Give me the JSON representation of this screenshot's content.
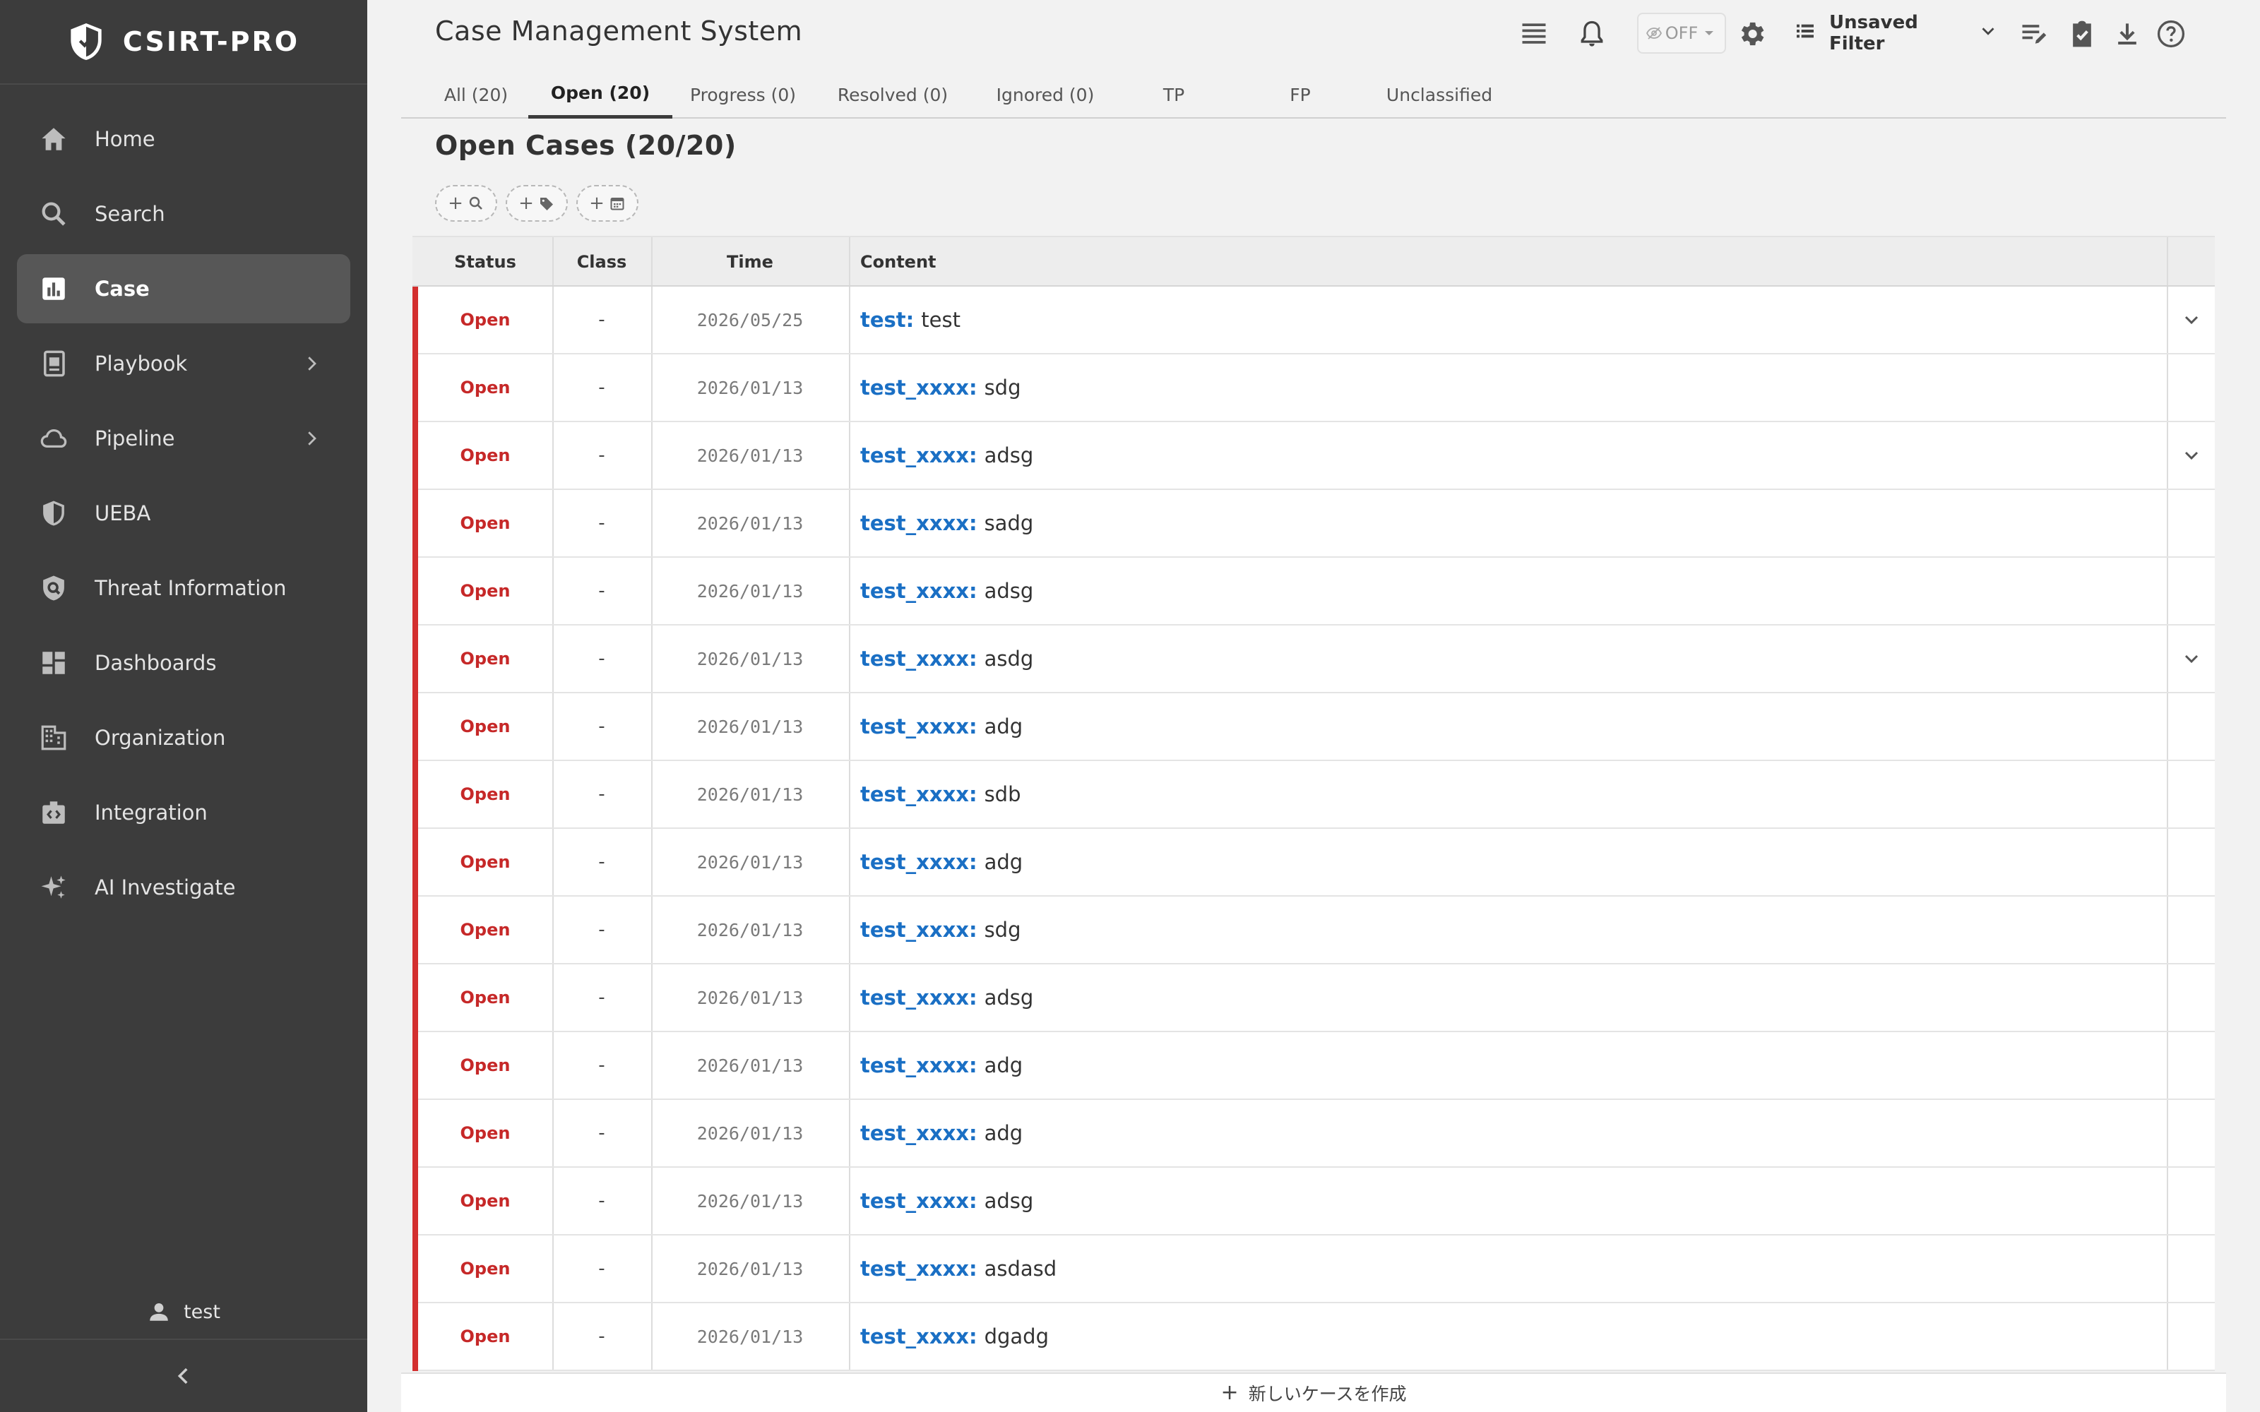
{
  "brand": {
    "name": "CSIRT-PRO"
  },
  "sidebar": {
    "items": [
      {
        "label": "Home",
        "icon": "home-icon",
        "active": false,
        "has_submenu": false
      },
      {
        "label": "Search",
        "icon": "search-icon",
        "active": false,
        "has_submenu": false
      },
      {
        "label": "Case",
        "icon": "chart-icon",
        "active": true,
        "has_submenu": false
      },
      {
        "label": "Playbook",
        "icon": "book-icon",
        "active": false,
        "has_submenu": true
      },
      {
        "label": "Pipeline",
        "icon": "cloud-icon",
        "active": false,
        "has_submenu": true
      },
      {
        "label": "UEBA",
        "icon": "shield-icon",
        "active": false,
        "has_submenu": false
      },
      {
        "label": "Threat Information",
        "icon": "threat-shield-icon",
        "active": false,
        "has_submenu": false
      },
      {
        "label": "Dashboards",
        "icon": "dashboard-icon",
        "active": false,
        "has_submenu": false
      },
      {
        "label": "Organization",
        "icon": "building-icon",
        "active": false,
        "has_submenu": false
      },
      {
        "label": "Integration",
        "icon": "integration-icon",
        "active": false,
        "has_submenu": false
      },
      {
        "label": "AI Investigate",
        "icon": "sparkle-icon",
        "active": false,
        "has_submenu": false
      }
    ],
    "user": "test"
  },
  "header": {
    "title": "Case Management System",
    "toggle_label": "OFF",
    "filter_label": "Unsaved Filter"
  },
  "tabs": [
    {
      "label": "All (20)",
      "active": false
    },
    {
      "label": "Open (20)",
      "active": true
    },
    {
      "label": "Progress (0)",
      "active": false
    },
    {
      "label": "Resolved (0)",
      "active": false
    },
    {
      "label": "Ignored (0)",
      "active": false
    },
    {
      "label": "TP",
      "active": false
    },
    {
      "label": "FP",
      "active": false
    },
    {
      "label": "Unclassified",
      "active": false
    }
  ],
  "section": {
    "title": "Open Cases (20/20)"
  },
  "filter_chips": [
    {
      "name": "add-search-filter-button",
      "icon": "search-icon"
    },
    {
      "name": "add-tag-filter-button",
      "icon": "tag-icon"
    },
    {
      "name": "add-date-filter-button",
      "icon": "calendar-icon"
    }
  ],
  "table": {
    "columns": [
      "Status",
      "Class",
      "Time",
      "Content"
    ],
    "rows": [
      {
        "status": "Open",
        "class": "-",
        "time": "2026/05/25",
        "key": "test:",
        "text": "test",
        "expandable": true
      },
      {
        "status": "Open",
        "class": "-",
        "time": "2026/01/13",
        "key": "test_xxxx:",
        "text": "sdg",
        "expandable": false
      },
      {
        "status": "Open",
        "class": "-",
        "time": "2026/01/13",
        "key": "test_xxxx:",
        "text": "adsg",
        "expandable": true
      },
      {
        "status": "Open",
        "class": "-",
        "time": "2026/01/13",
        "key": "test_xxxx:",
        "text": "sadg",
        "expandable": false
      },
      {
        "status": "Open",
        "class": "-",
        "time": "2026/01/13",
        "key": "test_xxxx:",
        "text": "adsg",
        "expandable": false
      },
      {
        "status": "Open",
        "class": "-",
        "time": "2026/01/13",
        "key": "test_xxxx:",
        "text": "asdg",
        "expandable": true
      },
      {
        "status": "Open",
        "class": "-",
        "time": "2026/01/13",
        "key": "test_xxxx:",
        "text": "adg",
        "expandable": false
      },
      {
        "status": "Open",
        "class": "-",
        "time": "2026/01/13",
        "key": "test_xxxx:",
        "text": "sdb",
        "expandable": false
      },
      {
        "status": "Open",
        "class": "-",
        "time": "2026/01/13",
        "key": "test_xxxx:",
        "text": "adg",
        "expandable": false
      },
      {
        "status": "Open",
        "class": "-",
        "time": "2026/01/13",
        "key": "test_xxxx:",
        "text": "sdg",
        "expandable": false
      },
      {
        "status": "Open",
        "class": "-",
        "time": "2026/01/13",
        "key": "test_xxxx:",
        "text": "adsg",
        "expandable": false
      },
      {
        "status": "Open",
        "class": "-",
        "time": "2026/01/13",
        "key": "test_xxxx:",
        "text": "adg",
        "expandable": false
      },
      {
        "status": "Open",
        "class": "-",
        "time": "2026/01/13",
        "key": "test_xxxx:",
        "text": "adg",
        "expandable": false
      },
      {
        "status": "Open",
        "class": "-",
        "time": "2026/01/13",
        "key": "test_xxxx:",
        "text": "adsg",
        "expandable": false
      },
      {
        "status": "Open",
        "class": "-",
        "time": "2026/01/13",
        "key": "test_xxxx:",
        "text": "asdasd",
        "expandable": false
      },
      {
        "status": "Open",
        "class": "-",
        "time": "2026/01/13",
        "key": "test_xxxx:",
        "text": "dgadg",
        "expandable": false
      }
    ]
  },
  "footer": {
    "new_case_label": "新しいケースを作成"
  },
  "colors": {
    "sidebar_bg": "#3c3c3c",
    "active_item_bg": "#575757",
    "status_open": "#c62828",
    "row_bar": "#d32f2f",
    "link": "#1a6fc4"
  }
}
